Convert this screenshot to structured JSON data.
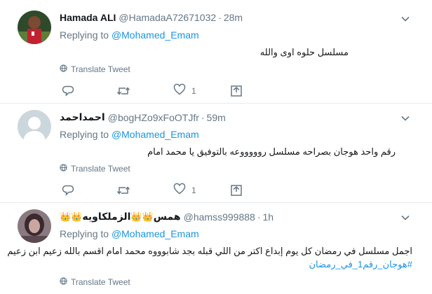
{
  "tweets": [
    {
      "name": "Hamada ALI",
      "handle": "@HamadaA72671032",
      "time": "28m",
      "replying_prefix": "Replying to",
      "replying_to": "@Mohamed_Emam",
      "text_lines": [
        "مسلسل حلوه اوى والله"
      ],
      "translate": "Translate Tweet",
      "likes": "1"
    },
    {
      "name": "احمداحمد",
      "handle": "@bogHZo9xFoOTJfr",
      "time": "59m",
      "replying_prefix": "Replying to",
      "replying_to": "@Mohamed_Emam",
      "text_lines": [
        "رقم واحد هوجان بصراحه مسلسل روووووعه بالتوفيق يا محمد امام"
      ],
      "translate": "Translate Tweet",
      "likes": "1"
    },
    {
      "name": "👑👑همس👑👑الزملكاويه",
      "name_core": "همس",
      "name_suffix": "الزملكاويه",
      "handle": "@hamss999888",
      "time": "1h",
      "replying_prefix": "Replying to",
      "replying_to": "@Mohamed_Emam",
      "text_lines": [
        "اجمل مسلسل في رمضان كل يوم إبداع اكتر من اللي قبله بجد شابوووه محمد امام اقسم بالله زعيم ابن زعيم"
      ],
      "hashtag": "#هوجان_رقم1_في_رمضان",
      "translate": "Translate Tweet"
    }
  ],
  "icons": {
    "reply": "reply-icon",
    "retweet": "retweet-icon",
    "like": "heart-icon",
    "dm": "direct-message-icon",
    "more": "chevron-down-icon",
    "translate": "globe-icon"
  },
  "colors": {
    "link": "#1b95e0",
    "secondary_text": "#657786",
    "divider": "#e6ecf0"
  }
}
